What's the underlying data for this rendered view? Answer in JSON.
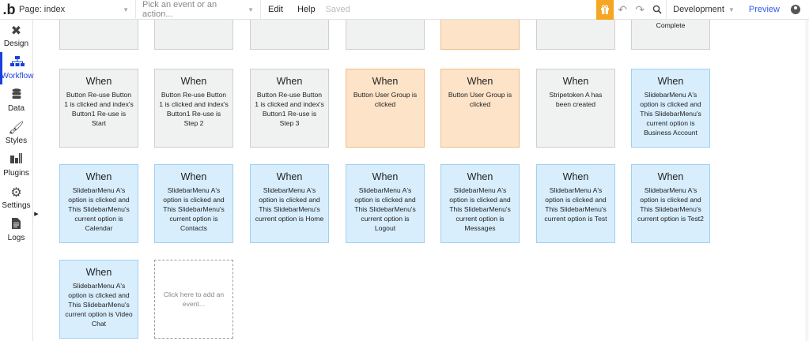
{
  "topbar": {
    "logo": ".b",
    "page_label": "Page: index",
    "event_placeholder": "Pick an event or an action...",
    "menu": [
      "Edit",
      "Help"
    ],
    "saved": "Saved",
    "environment": "Development",
    "preview": "Preview"
  },
  "sidebar": {
    "items": [
      {
        "label": "Design",
        "icon": "design-icon"
      },
      {
        "label": "Workflow",
        "icon": "workflow-icon",
        "active": true
      },
      {
        "label": "Data",
        "icon": "data-icon"
      },
      {
        "label": "Styles",
        "icon": "styles-icon"
      },
      {
        "label": "Plugins",
        "icon": "plugins-icon"
      },
      {
        "label": "Settings",
        "icon": "settings-icon"
      },
      {
        "label": "Logs",
        "icon": "logs-icon"
      }
    ]
  },
  "events": {
    "top_row": [
      {
        "color": "gray",
        "desc": ""
      },
      {
        "color": "gray",
        "desc": ""
      },
      {
        "color": "gray",
        "desc": ""
      },
      {
        "color": "gray",
        "desc": ""
      },
      {
        "color": "orange",
        "desc": ""
      },
      {
        "color": "gray",
        "desc": ""
      },
      {
        "color": "gray",
        "desc": "Complete"
      }
    ],
    "row1": [
      {
        "color": "gray",
        "when": "When",
        "desc": "Button Re-use Button 1 is clicked and index's Button1 Re-use is Start"
      },
      {
        "color": "gray",
        "when": "When",
        "desc": "Button Re-use Button 1 is clicked and index's Button1 Re-use is Step 2"
      },
      {
        "color": "gray",
        "when": "When",
        "desc": "Button Re-use Button 1 is clicked and index's Button1 Re-use is Step 3"
      },
      {
        "color": "orange",
        "when": "When",
        "desc": "Button User Group is clicked"
      },
      {
        "color": "orange",
        "when": "When",
        "desc": "Button User Group is clicked"
      },
      {
        "color": "gray",
        "when": "When",
        "desc": "Stripetoken A has been created"
      },
      {
        "color": "blue",
        "when": "When",
        "desc": "SlidebarMenu A's option is clicked and This SlidebarMenu's current option is Business Account"
      }
    ],
    "row2": [
      {
        "color": "blue",
        "when": "When",
        "desc": "SlidebarMenu A's option is clicked and This SlidebarMenu's current option is Calendar"
      },
      {
        "color": "blue",
        "when": "When",
        "desc": "SlidebarMenu A's option is clicked and This SlidebarMenu's current option is Contacts"
      },
      {
        "color": "blue",
        "when": "When",
        "desc": "SlidebarMenu A's option is clicked and This SlidebarMenu's current option is Home"
      },
      {
        "color": "blue",
        "when": "When",
        "desc": "SlidebarMenu A's option is clicked and This SlidebarMenu's current option is Logout"
      },
      {
        "color": "blue",
        "when": "When",
        "desc": "SlidebarMenu A's option is clicked and This SlidebarMenu's current option is Messages"
      },
      {
        "color": "blue",
        "when": "When",
        "desc": "SlidebarMenu A's option is clicked and This SlidebarMenu's current option is Test"
      },
      {
        "color": "blue",
        "when": "When",
        "desc": "SlidebarMenu A's option is clicked and This SlidebarMenu's current option is Test2"
      }
    ],
    "row3": [
      {
        "color": "blue",
        "when": "When",
        "desc": "SlidebarMenu A's option is clicked and This SlidebarMenu's current option is Video Chat"
      }
    ],
    "add_event": "Click here to add an event..."
  }
}
